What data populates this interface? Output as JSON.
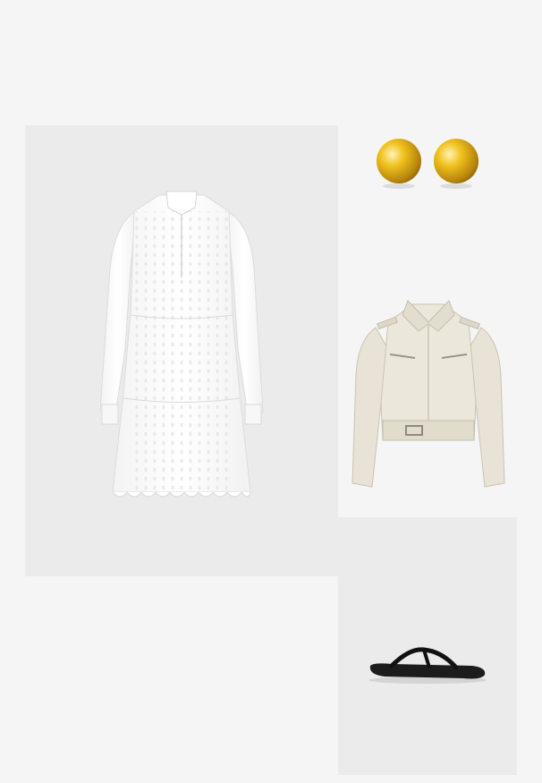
{
  "canvas": {
    "background": "#f5f5f5",
    "tile_background": "#ebebeb"
  },
  "items": [
    {
      "id": "dress",
      "type": "white broderie anglaise tiered long-sleeve shirt dress",
      "color": "#fbfbfb"
    },
    {
      "id": "earrings",
      "type": "gold dome stud earrings",
      "color": "#d4a414"
    },
    {
      "id": "jacket",
      "type": "cream cropped utility jacket",
      "color": "#e8e3d6"
    },
    {
      "id": "sandals",
      "type": "black thong flat sandal",
      "color": "#1c1c1c"
    }
  ]
}
